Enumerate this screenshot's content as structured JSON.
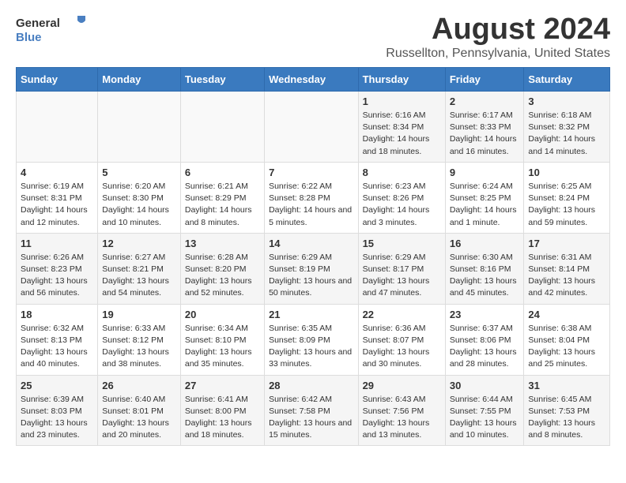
{
  "logo": {
    "line1": "General",
    "line2": "Blue"
  },
  "title": "August 2024",
  "subtitle": "Russellton, Pennsylvania, United States",
  "days_of_week": [
    "Sunday",
    "Monday",
    "Tuesday",
    "Wednesday",
    "Thursday",
    "Friday",
    "Saturday"
  ],
  "weeks": [
    [
      {
        "day": "",
        "sunrise": "",
        "sunset": "",
        "daylight": ""
      },
      {
        "day": "",
        "sunrise": "",
        "sunset": "",
        "daylight": ""
      },
      {
        "day": "",
        "sunrise": "",
        "sunset": "",
        "daylight": ""
      },
      {
        "day": "",
        "sunrise": "",
        "sunset": "",
        "daylight": ""
      },
      {
        "day": "1",
        "sunrise": "6:16 AM",
        "sunset": "8:34 PM",
        "daylight": "14 hours and 18 minutes."
      },
      {
        "day": "2",
        "sunrise": "6:17 AM",
        "sunset": "8:33 PM",
        "daylight": "14 hours and 16 minutes."
      },
      {
        "day": "3",
        "sunrise": "6:18 AM",
        "sunset": "8:32 PM",
        "daylight": "14 hours and 14 minutes."
      }
    ],
    [
      {
        "day": "4",
        "sunrise": "6:19 AM",
        "sunset": "8:31 PM",
        "daylight": "14 hours and 12 minutes."
      },
      {
        "day": "5",
        "sunrise": "6:20 AM",
        "sunset": "8:30 PM",
        "daylight": "14 hours and 10 minutes."
      },
      {
        "day": "6",
        "sunrise": "6:21 AM",
        "sunset": "8:29 PM",
        "daylight": "14 hours and 8 minutes."
      },
      {
        "day": "7",
        "sunrise": "6:22 AM",
        "sunset": "8:28 PM",
        "daylight": "14 hours and 5 minutes."
      },
      {
        "day": "8",
        "sunrise": "6:23 AM",
        "sunset": "8:26 PM",
        "daylight": "14 hours and 3 minutes."
      },
      {
        "day": "9",
        "sunrise": "6:24 AM",
        "sunset": "8:25 PM",
        "daylight": "14 hours and 1 minute."
      },
      {
        "day": "10",
        "sunrise": "6:25 AM",
        "sunset": "8:24 PM",
        "daylight": "13 hours and 59 minutes."
      }
    ],
    [
      {
        "day": "11",
        "sunrise": "6:26 AM",
        "sunset": "8:23 PM",
        "daylight": "13 hours and 56 minutes."
      },
      {
        "day": "12",
        "sunrise": "6:27 AM",
        "sunset": "8:21 PM",
        "daylight": "13 hours and 54 minutes."
      },
      {
        "day": "13",
        "sunrise": "6:28 AM",
        "sunset": "8:20 PM",
        "daylight": "13 hours and 52 minutes."
      },
      {
        "day": "14",
        "sunrise": "6:29 AM",
        "sunset": "8:19 PM",
        "daylight": "13 hours and 50 minutes."
      },
      {
        "day": "15",
        "sunrise": "6:29 AM",
        "sunset": "8:17 PM",
        "daylight": "13 hours and 47 minutes."
      },
      {
        "day": "16",
        "sunrise": "6:30 AM",
        "sunset": "8:16 PM",
        "daylight": "13 hours and 45 minutes."
      },
      {
        "day": "17",
        "sunrise": "6:31 AM",
        "sunset": "8:14 PM",
        "daylight": "13 hours and 42 minutes."
      }
    ],
    [
      {
        "day": "18",
        "sunrise": "6:32 AM",
        "sunset": "8:13 PM",
        "daylight": "13 hours and 40 minutes."
      },
      {
        "day": "19",
        "sunrise": "6:33 AM",
        "sunset": "8:12 PM",
        "daylight": "13 hours and 38 minutes."
      },
      {
        "day": "20",
        "sunrise": "6:34 AM",
        "sunset": "8:10 PM",
        "daylight": "13 hours and 35 minutes."
      },
      {
        "day": "21",
        "sunrise": "6:35 AM",
        "sunset": "8:09 PM",
        "daylight": "13 hours and 33 minutes."
      },
      {
        "day": "22",
        "sunrise": "6:36 AM",
        "sunset": "8:07 PM",
        "daylight": "13 hours and 30 minutes."
      },
      {
        "day": "23",
        "sunrise": "6:37 AM",
        "sunset": "8:06 PM",
        "daylight": "13 hours and 28 minutes."
      },
      {
        "day": "24",
        "sunrise": "6:38 AM",
        "sunset": "8:04 PM",
        "daylight": "13 hours and 25 minutes."
      }
    ],
    [
      {
        "day": "25",
        "sunrise": "6:39 AM",
        "sunset": "8:03 PM",
        "daylight": "13 hours and 23 minutes."
      },
      {
        "day": "26",
        "sunrise": "6:40 AM",
        "sunset": "8:01 PM",
        "daylight": "13 hours and 20 minutes."
      },
      {
        "day": "27",
        "sunrise": "6:41 AM",
        "sunset": "8:00 PM",
        "daylight": "13 hours and 18 minutes."
      },
      {
        "day": "28",
        "sunrise": "6:42 AM",
        "sunset": "7:58 PM",
        "daylight": "13 hours and 15 minutes."
      },
      {
        "day": "29",
        "sunrise": "6:43 AM",
        "sunset": "7:56 PM",
        "daylight": "13 hours and 13 minutes."
      },
      {
        "day": "30",
        "sunrise": "6:44 AM",
        "sunset": "7:55 PM",
        "daylight": "13 hours and 10 minutes."
      },
      {
        "day": "31",
        "sunrise": "6:45 AM",
        "sunset": "7:53 PM",
        "daylight": "13 hours and 8 minutes."
      }
    ]
  ]
}
